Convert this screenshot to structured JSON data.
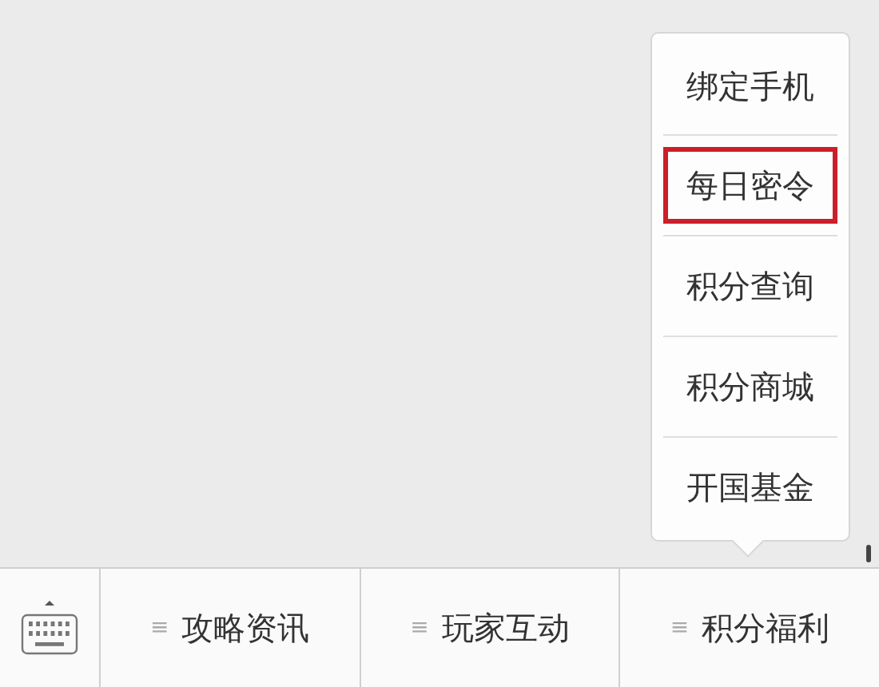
{
  "tabs": [
    {
      "label": "攻略资讯",
      "icon": "≡"
    },
    {
      "label": "玩家互动",
      "icon": "≡"
    },
    {
      "label": "积分福利",
      "icon": "≡",
      "submenu": [
        {
          "label": "绑定手机",
          "highlighted": false
        },
        {
          "label": "每日密令",
          "highlighted": true
        },
        {
          "label": "积分查询",
          "highlighted": false
        },
        {
          "label": "积分商城",
          "highlighted": false
        },
        {
          "label": "开国基金",
          "highlighted": false
        }
      ]
    }
  ]
}
